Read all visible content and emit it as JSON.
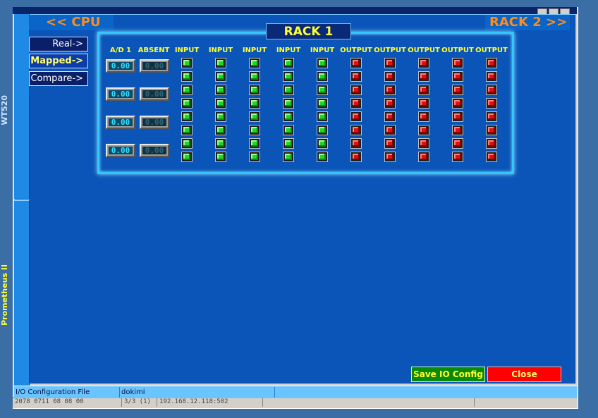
{
  "background_window": {
    "status_cells": [
      "2078 0711 08 08 00",
      "3/3 (1)",
      "192.168.12.118:502"
    ]
  },
  "side_tabs": [
    "WT520",
    "Prometheus II"
  ],
  "nav": {
    "prev": "<< CPU",
    "next": "RACK 2 >>"
  },
  "modes": [
    "Real->",
    "Mapped->",
    "Compare->"
  ],
  "rack": {
    "title": "RACK 1",
    "columns": [
      "A/D 1",
      "ABSENT",
      "INPUT",
      "INPUT",
      "INPUT",
      "INPUT",
      "INPUT",
      "OUTPUT",
      "OUTPUT",
      "OUTPUT",
      "OUTPUT",
      "OUTPUT"
    ],
    "ad_values": [
      "0.00",
      "0.00",
      "0.00",
      "0.00"
    ],
    "absent_values": [
      "0.00",
      "0.00",
      "0.00",
      "0.00"
    ],
    "input_states": [
      "on",
      "on",
      "on",
      "on",
      "on",
      "on",
      "on",
      "on"
    ],
    "output_states": [
      "on",
      "on",
      "on",
      "on",
      "on",
      "on",
      "on",
      "on"
    ],
    "colors": {
      "input_led": "#22d622",
      "output_led": "#e01010",
      "header": "#ffff33",
      "panel": "#0b55b8"
    }
  },
  "buttons": {
    "save": "Save IO Config",
    "close": "Close"
  },
  "status": {
    "label": "I/O Configuration File",
    "value": "dokimi"
  }
}
